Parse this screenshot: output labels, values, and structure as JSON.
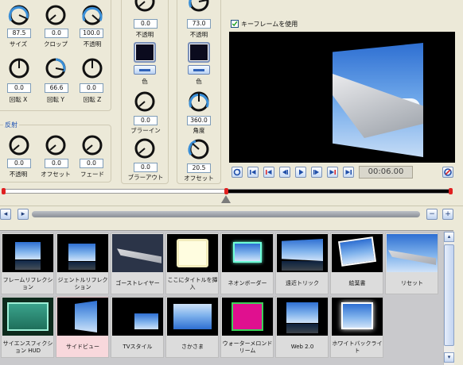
{
  "left_panel": {
    "knobs_row1": [
      {
        "value": "87.5",
        "label": "サイズ"
      },
      {
        "value": "0.0",
        "label": "クロップ"
      },
      {
        "value": "100.0",
        "label": "不透明"
      }
    ],
    "knobs_row2": [
      {
        "value": "0.0",
        "label": "回転 X"
      },
      {
        "value": "66.6",
        "label": "回転 Y"
      },
      {
        "value": "0.0",
        "label": "回転 Z"
      }
    ],
    "reflection_title": "反射",
    "knobs_row3": [
      {
        "value": "0.0",
        "label": "不透明"
      },
      {
        "value": "0.0",
        "label": "オフセット"
      },
      {
        "value": "0.0",
        "label": "フェード"
      }
    ]
  },
  "mid_panel": {
    "top_value": "0.0",
    "top_label": "不透明",
    "color_label": "色",
    "blur_in_value": "0.0",
    "blur_in_label": "ブラーイン",
    "blur_out_value": "0.0",
    "blur_out_label": "ブラーアウト"
  },
  "right_panel": {
    "top_value": "73.0",
    "top_label": "不透明",
    "color_label": "色",
    "angle_value": "360.0",
    "angle_label": "角度",
    "offset_value": "20.5",
    "offset_label": "オフセット"
  },
  "preview": {
    "keyframe_checkbox_label": "キーフレームを使用",
    "keyframe_checked": true,
    "timecode": "00:06.00"
  },
  "presets": [
    {
      "label": "フレームリフレクション"
    },
    {
      "label": "ジェントルリフレクション"
    },
    {
      "label": "ゴーストレイヤー"
    },
    {
      "label": "ここにタイトルを挿入"
    },
    {
      "label": "ネオンボーダー"
    },
    {
      "label": "遠近トリック"
    },
    {
      "label": "絵葉書"
    },
    {
      "label": "リセット"
    },
    {
      "label": "サイエンスフィクション HUD"
    },
    {
      "label": "サイドビュー"
    },
    {
      "label": "TVスタイル"
    },
    {
      "label": "さかさま"
    },
    {
      "label": "ウォーターメロンドリーム"
    },
    {
      "label": "Web 2.0"
    },
    {
      "label": "ホワイトバックライト"
    }
  ],
  "colors": {
    "panel_bg": "#ece9d8",
    "knob_arc": "#3a8fd8",
    "selected_tile": "#f8d8dc",
    "timeline_marker": "#e02020"
  }
}
